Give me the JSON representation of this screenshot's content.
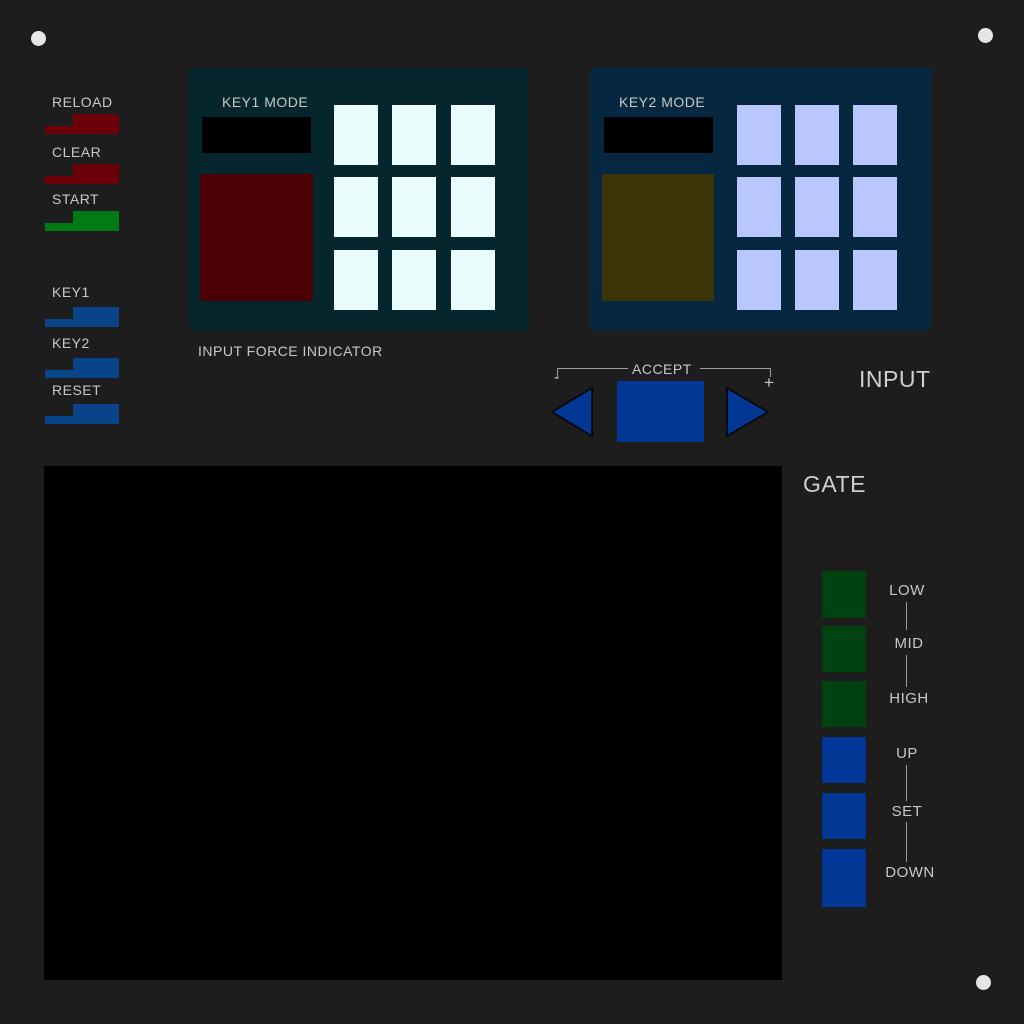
{
  "colors": {
    "background": "#1d1d1d",
    "red_button": "#6b0008",
    "green_button": "#007a12",
    "blue_button": "#0a4488",
    "key1_panel": "#04262c",
    "key1_indicator": "#4a0004",
    "key1_key": "#eafdfd",
    "key2_panel": "#05273f",
    "key2_indicator": "#3c3307",
    "key2_key": "#bac7ff",
    "accept_blue": "#023796",
    "gate_green": "#004210",
    "gate_blue": "#023796",
    "screen": "#000000"
  },
  "left_controls": {
    "reload": "RELOAD",
    "clear": "CLEAR",
    "start": "START",
    "key1": "KEY1",
    "key2": "KEY2",
    "reset": "RESET"
  },
  "key1_panel": {
    "title": "KEY1 MODE",
    "keys": [
      "",
      "",
      "",
      "",
      "",
      "",
      "",
      "",
      ""
    ]
  },
  "key2_panel": {
    "title": "KEY2 MODE",
    "keys": [
      "",
      "",
      "",
      "",
      "",
      "",
      "",
      "",
      ""
    ]
  },
  "input_force_label": "INPUT FORCE INDICATOR",
  "accept": {
    "label": "ACCEPT",
    "minus": "-",
    "plus": "+"
  },
  "section_input": "INPUT",
  "section_gate": "GATE",
  "gate": {
    "low": "LOW",
    "mid": "MID",
    "high": "HIGH",
    "up": "UP",
    "set": "SET",
    "down": "DOWN"
  }
}
